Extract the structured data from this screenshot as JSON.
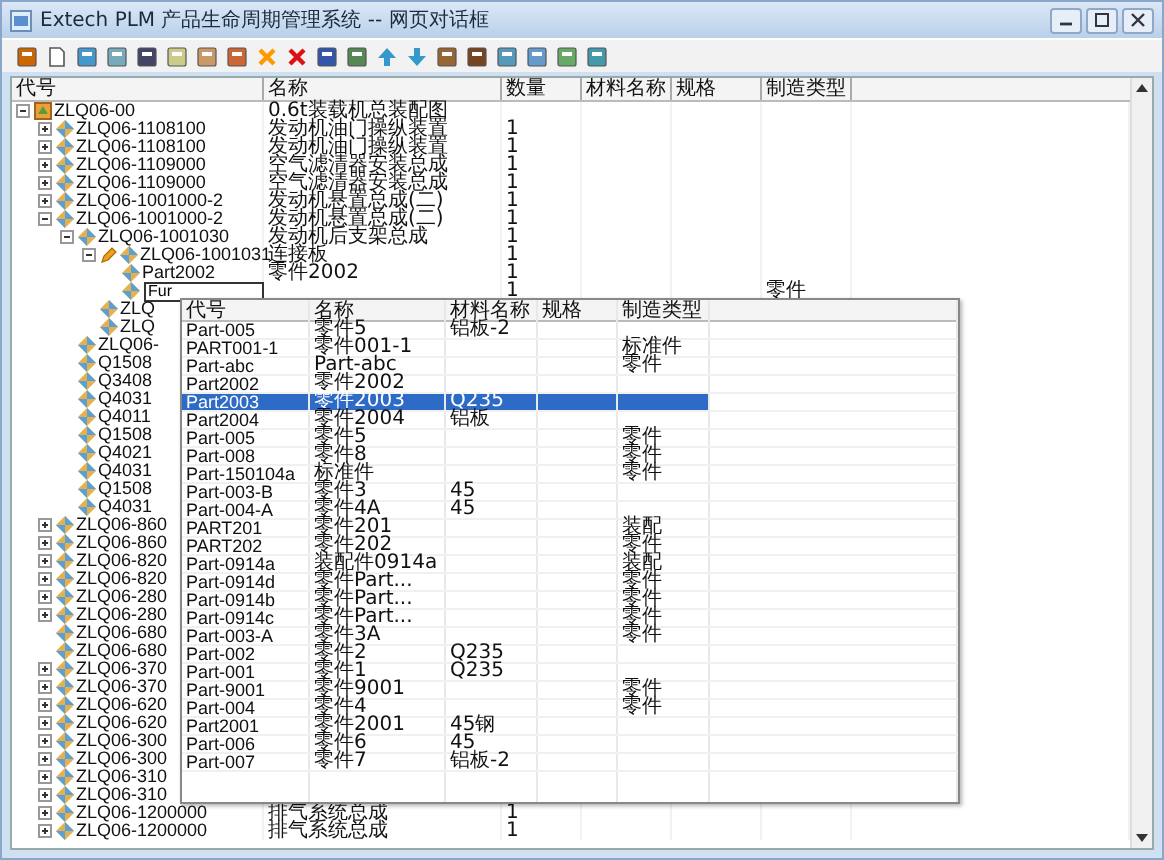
{
  "window": {
    "title": "Extech PLM 产品生命周期管理系统 -- 网页对话框"
  },
  "columns": [
    "代号",
    "名称",
    "数量",
    "材料名称",
    "规格",
    "制造类型"
  ],
  "tree": [
    {
      "kind": "root",
      "code": "ZLQ06-00",
      "name": "0.6t装载机总装配图",
      "expanded": true,
      "children": [
        {
          "kind": "part",
          "code": "ZLQ06-1108100",
          "name": "发动机油门操纵装置",
          "qty": "1",
          "expanded": false
        },
        {
          "kind": "part",
          "code": "ZLQ06-1108100",
          "name": "发动机油门操纵装置",
          "qty": "1",
          "expanded": false
        },
        {
          "kind": "part",
          "code": "ZLQ06-1109000",
          "name": "空气滤清器安装总成",
          "qty": "1",
          "expanded": false
        },
        {
          "kind": "part",
          "code": "ZLQ06-1109000",
          "name": "空气滤清器安装总成",
          "qty": "1",
          "expanded": false
        },
        {
          "kind": "part",
          "code": "ZLQ06-1001000-2",
          "name": "发动机悬置总成(二)",
          "qty": "1",
          "expanded": false
        },
        {
          "kind": "part",
          "code": "ZLQ06-1001000-2",
          "name": "发动机悬置总成(二)",
          "qty": "1",
          "expanded": true,
          "children": [
            {
              "kind": "part",
              "code": "ZLQ06-1001030",
              "name": "发动机后支架总成",
              "qty": "1",
              "expanded": true,
              "children": [
                {
                  "kind": "part",
                  "code": "ZLQ06-1001031",
                  "name": "连接板",
                  "qty": "1",
                  "expanded": true,
                  "editing": true,
                  "children": [
                    {
                      "kind": "part",
                      "code": "Part2002",
                      "name": "零件2002",
                      "qty": "1"
                    },
                    {
                      "kind": "input",
                      "code": "Fur",
                      "qty": "1",
                      "type": "零件"
                    }
                  ]
                },
                {
                  "kind": "part",
                  "code": "ZLQ"
                },
                {
                  "kind": "part",
                  "code": "ZLQ"
                }
              ]
            },
            {
              "kind": "part",
              "code": "ZLQ06-"
            },
            {
              "kind": "part",
              "code": "Q1508"
            },
            {
              "kind": "part",
              "code": "Q3408"
            },
            {
              "kind": "part",
              "code": "Q4031"
            },
            {
              "kind": "part",
              "code": "Q4011"
            },
            {
              "kind": "part",
              "code": "Q1508"
            },
            {
              "kind": "part",
              "code": "Q4021"
            },
            {
              "kind": "part",
              "code": "Q4031"
            },
            {
              "kind": "part",
              "code": "Q1508"
            },
            {
              "kind": "part",
              "code": "Q4031"
            }
          ]
        },
        {
          "kind": "part",
          "code": "ZLQ06-860",
          "expanded": false
        },
        {
          "kind": "part",
          "code": "ZLQ06-860",
          "expanded": false
        },
        {
          "kind": "part",
          "code": "ZLQ06-820",
          "expanded": false
        },
        {
          "kind": "part",
          "code": "ZLQ06-820",
          "expanded": false
        },
        {
          "kind": "part",
          "code": "ZLQ06-280",
          "expanded": false
        },
        {
          "kind": "part",
          "code": "ZLQ06-280",
          "expanded": false
        },
        {
          "kind": "part",
          "code": "ZLQ06-680"
        },
        {
          "kind": "part",
          "code": "ZLQ06-680"
        },
        {
          "kind": "part",
          "code": "ZLQ06-370",
          "expanded": false
        },
        {
          "kind": "part",
          "code": "ZLQ06-370",
          "expanded": false
        },
        {
          "kind": "part",
          "code": "ZLQ06-620",
          "expanded": false
        },
        {
          "kind": "part",
          "code": "ZLQ06-620",
          "expanded": false
        },
        {
          "kind": "part",
          "code": "ZLQ06-300",
          "expanded": false
        },
        {
          "kind": "part",
          "code": "ZLQ06-300",
          "expanded": false
        },
        {
          "kind": "part",
          "code": "ZLQ06-310",
          "expanded": false
        },
        {
          "kind": "part",
          "code": "ZLQ06-310",
          "expanded": false
        },
        {
          "kind": "part",
          "code": "ZLQ06-1200000",
          "name": "排气系统总成",
          "qty": "1",
          "expanded": false
        },
        {
          "kind": "part",
          "code": "ZLQ06-1200000",
          "name": "排气系统总成",
          "qty": "1",
          "expanded": false
        }
      ]
    }
  ],
  "picker": {
    "columns": [
      "代号",
      "名称",
      "材料名称",
      "规格",
      "制造类型"
    ],
    "rows": [
      {
        "code": "Part-005",
        "name": "零件5",
        "material": "铝板-2",
        "selected": false
      },
      {
        "code": "PART001-1",
        "name": "零件001-1",
        "type": "标准件",
        "selected": false
      },
      {
        "code": "Part-abc",
        "name": "Part-abc",
        "type": "零件",
        "selected": false
      },
      {
        "code": "Part2002",
        "name": "零件2002",
        "selected": false
      },
      {
        "code": "Part2003",
        "name": "零件2003",
        "material": "Q235",
        "selected": true
      },
      {
        "code": "Part2004",
        "name": "零件2004",
        "material": "铝板",
        "selected": false
      },
      {
        "code": "Part-005",
        "name": "零件5",
        "type": "零件",
        "selected": false
      },
      {
        "code": "Part-008",
        "name": "零件8",
        "type": "零件",
        "selected": false
      },
      {
        "code": "Part-150104a",
        "name": "标准件",
        "type": "零件",
        "selected": false
      },
      {
        "code": "Part-003-B",
        "name": "零件3",
        "material": "45",
        "selected": false
      },
      {
        "code": "Part-004-A",
        "name": "零件4A",
        "material": "45",
        "selected": false
      },
      {
        "code": "PART201",
        "name": "零件201",
        "type": "装配",
        "selected": false
      },
      {
        "code": "PART202",
        "name": "零件202",
        "type": "零件",
        "selected": false
      },
      {
        "code": "Part-0914a",
        "name": "装配件0914a",
        "type": "装配",
        "selected": false
      },
      {
        "code": "Part-0914d",
        "name": "零件Part...",
        "type": "零件",
        "selected": false
      },
      {
        "code": "Part-0914b",
        "name": "零件Part...",
        "type": "零件",
        "selected": false
      },
      {
        "code": "Part-0914c",
        "name": "零件Part...",
        "type": "零件",
        "selected": false
      },
      {
        "code": "Part-003-A",
        "name": "零件3A",
        "type": "零件",
        "selected": false
      },
      {
        "code": "Part-002",
        "name": "零件2",
        "material": "Q235",
        "selected": false
      },
      {
        "code": "Part-001",
        "name": "零件1",
        "material": "Q235",
        "selected": false
      },
      {
        "code": "Part-9001",
        "name": "零件9001",
        "type": "零件",
        "selected": false
      },
      {
        "code": "Part-004",
        "name": "零件4",
        "type": "零件",
        "selected": false
      },
      {
        "code": "Part2001",
        "name": "零件2001",
        "material": "45钢",
        "selected": false
      },
      {
        "code": "Part-006",
        "name": "零件6",
        "material": "45",
        "selected": false
      },
      {
        "code": "Part-007",
        "name": "零件7",
        "material": "铝板-2",
        "selected": false
      }
    ]
  }
}
